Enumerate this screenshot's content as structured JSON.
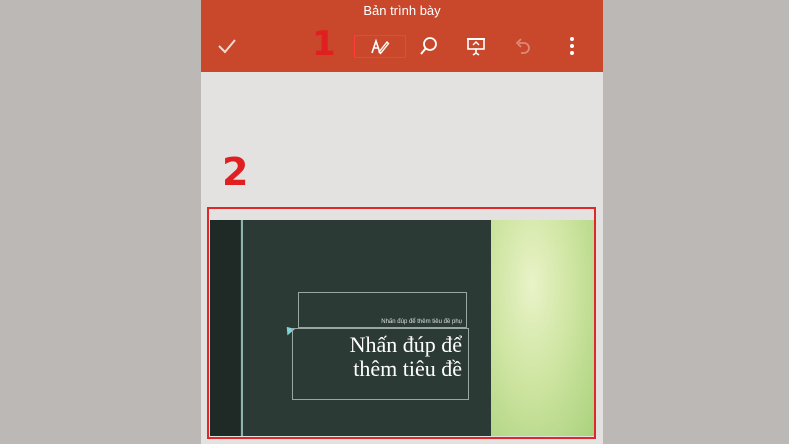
{
  "app": {
    "document_title": "Bản trình bày"
  },
  "toolbar": {
    "accent_color": "#c9472b",
    "buttons": [
      {
        "name": "done",
        "icon": "checkmark-icon"
      },
      {
        "name": "draw",
        "icon": "pen-draw-icon"
      },
      {
        "name": "search",
        "icon": "search-icon"
      },
      {
        "name": "present",
        "icon": "presentation-icon"
      },
      {
        "name": "undo",
        "icon": "undo-icon"
      },
      {
        "name": "more",
        "icon": "more-vertical-icon"
      }
    ]
  },
  "annotations": {
    "step1": "1",
    "step2": "2",
    "highlight_color": "#e0282a"
  },
  "slide": {
    "subtitle_placeholder": "Nhấn đúp để thêm tiêu đề phụ",
    "title_line1": "Nhấn đúp để",
    "title_line2": "thêm tiêu đề"
  }
}
